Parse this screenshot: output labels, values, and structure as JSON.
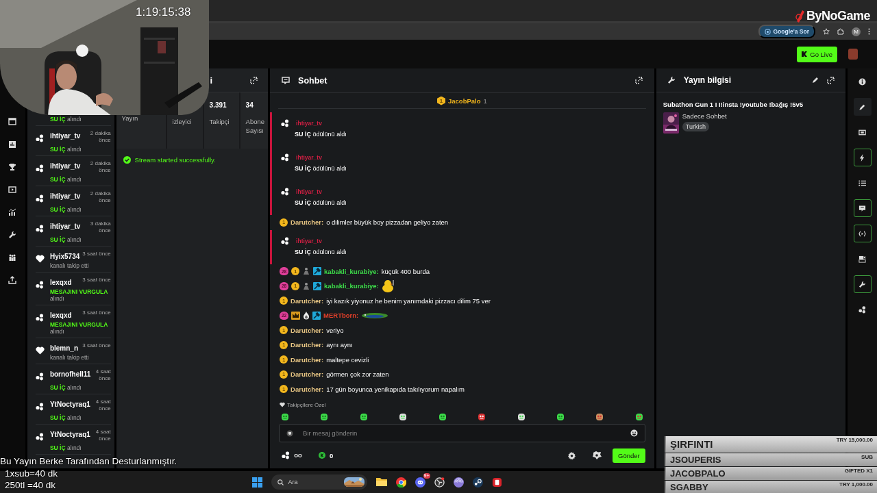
{
  "stream_timer": "1:19:15:38",
  "logo": "ByNoGame",
  "browser": {
    "ai_chip": "Google'a Sor",
    "profile": "M"
  },
  "header": {
    "go_live": "Go Live"
  },
  "activity_feed": [
    {
      "kind": "reward",
      "reward": "SU İÇ",
      "action": "alındı"
    },
    {
      "kind": "reward",
      "user": "ihtiyar_tv",
      "time": "2 dakika önce",
      "reward": "SU İÇ",
      "action": "alındı"
    },
    {
      "kind": "reward",
      "user": "ihtiyar_tv",
      "time": "2 dakika önce",
      "reward": "SU İÇ",
      "action": "alındı"
    },
    {
      "kind": "reward",
      "user": "ihtiyar_tv",
      "time": "2 dakika önce",
      "reward": "SU İÇ",
      "action": "alındı"
    },
    {
      "kind": "reward",
      "user": "ihtiyar_tv",
      "time": "3 dakika önce",
      "reward": "SU İÇ",
      "action": "alındı"
    },
    {
      "kind": "follow",
      "user": "Hyix5734",
      "time": "3 saat önce",
      "action": "kanalı takip etti"
    },
    {
      "kind": "reward",
      "user": "lexqxd",
      "time": "3 saat önce",
      "reward": "MESAJINI VURGULA",
      "action": "alındı"
    },
    {
      "kind": "reward",
      "user": "lexqxd",
      "time": "3 saat önce",
      "reward": "MESAJINI VURGULA",
      "action": "alındı"
    },
    {
      "kind": "follow",
      "user": "blemn_n",
      "time": "3 saat önce",
      "action": "kanalı takip etti"
    },
    {
      "kind": "reward",
      "user": "bornofhell11",
      "time": "4 saat önce",
      "reward": "SU İÇ",
      "action": "alındı"
    },
    {
      "kind": "reward",
      "user": "YtNoctyraq1",
      "time": "4 saat önce",
      "reward": "SU İÇ",
      "action": "alındı"
    },
    {
      "kind": "reward",
      "user": "YtNoctyraq1",
      "time": "4 saat önce",
      "reward": "SU İÇ",
      "action": "alındı"
    }
  ],
  "stats_panel": {
    "title": "i",
    "stats": [
      {
        "label": "Yayın"
      },
      {
        "label": "izleyici"
      },
      {
        "value": "3.391",
        "label": "Takipçi"
      },
      {
        "value": "34",
        "label": "Abone Sayısı"
      }
    ],
    "status": "Stream started successfully."
  },
  "chat": {
    "title": "Sohbet",
    "pinned": {
      "badge": "1",
      "user": "JacobPalo",
      "count": "1"
    },
    "messages": [
      {
        "kind": "reward",
        "user": "ihtiyar_tv",
        "color": "#d11f43",
        "text": "**SU İÇ** ödülünü aldı"
      },
      {
        "kind": "reward",
        "user": "ihtiyar_tv",
        "color": "#d11f43",
        "text": "**SU İÇ** ödülünü aldı"
      },
      {
        "kind": "reward",
        "user": "ihtiyar_tv",
        "color": "#d11f43",
        "text": "**SU İÇ** ödülünü aldı"
      },
      {
        "kind": "message",
        "badges": [
          {
            "kind": "gift",
            "label": "1"
          }
        ],
        "user": "Darutcher:",
        "color": "#e8c684",
        "text": "o dilimler büyük boy pizzadan geliyo zaten"
      },
      {
        "kind": "reward",
        "user": "ihtiyar_tv",
        "color": "#d11f43",
        "text": "**SU İÇ** ödülünü aldı"
      },
      {
        "kind": "message",
        "badges": [
          {
            "kind": "sub",
            "label": "28"
          },
          {
            "kind": "gift",
            "label": "1"
          },
          {
            "kind": "figure"
          },
          {
            "kind": "mod"
          }
        ],
        "user": "kabakli_kurabiye:",
        "color": "#3ddc4a",
        "text": "küçük 400 burda"
      },
      {
        "kind": "duck",
        "badges": [
          {
            "kind": "sub",
            "label": "28"
          },
          {
            "kind": "gift",
            "label": "1"
          },
          {
            "kind": "figure"
          },
          {
            "kind": "mod"
          }
        ],
        "user": "kabakli_kurabiye:",
        "color": "#3ddc4a"
      },
      {
        "kind": "message",
        "badges": [
          {
            "kind": "gift",
            "label": "1"
          }
        ],
        "user": "Darutcher:",
        "color": "#e8c684",
        "text": "iyi kazık yiyonuz he benim yanımdaki pizzacı dilim 75 ver"
      },
      {
        "kind": "lizard",
        "badges": [
          {
            "kind": "sub",
            "label": "22"
          },
          {
            "kind": "crown"
          },
          {
            "kind": "flame"
          },
          {
            "kind": "mod"
          }
        ],
        "user": "MERTborn:",
        "color": "#e8402a"
      },
      {
        "kind": "message",
        "badges": [
          {
            "kind": "gift",
            "label": "1"
          }
        ],
        "user": "Darutcher:",
        "color": "#e8c684",
        "text": "veriyo"
      },
      {
        "kind": "message",
        "badges": [
          {
            "kind": "gift",
            "label": "1"
          }
        ],
        "user": "Darutcher:",
        "color": "#e8c684",
        "text": "aynı aynı"
      },
      {
        "kind": "message",
        "badges": [
          {
            "kind": "gift",
            "label": "1"
          }
        ],
        "user": "Darutcher:",
        "color": "#e8c684",
        "text": "maltepe cevizli"
      },
      {
        "kind": "message",
        "badges": [
          {
            "kind": "gift",
            "label": "1"
          }
        ],
        "user": "Darutcher:",
        "color": "#e8c684",
        "text": "görmen çok zor zaten"
      },
      {
        "kind": "message",
        "badges": [
          {
            "kind": "gift",
            "label": "1"
          }
        ],
        "user": "Darutcher:",
        "color": "#e8c684",
        "text": "17 gün boyunca yenikapıda takılıyorum napalım"
      }
    ],
    "emote_section": "Takipçilere Özel",
    "input": {
      "placeholder": "Bir mesaj gönderin"
    },
    "points": "0",
    "send": "Gönder"
  },
  "stream_info": {
    "title": "Yayın bilgisi",
    "stream_title": "Subathon Gun 1 I I!insta !youtube !bağış !5v5",
    "category": "Sadece Sohbet",
    "tag": "Turkish"
  },
  "right_rail": [
    {
      "kind": "info",
      "outlined": false,
      "selected": false
    },
    {
      "kind": "pencil",
      "outlined": false,
      "selected": true
    },
    {
      "kind": "screen",
      "outlined": false,
      "selected": false
    },
    {
      "kind": "bolt",
      "outlined": true,
      "selected": false
    },
    {
      "kind": "list",
      "outlined": false,
      "selected": false
    },
    {
      "kind": "chat",
      "outlined": true,
      "selected": false
    },
    {
      "kind": "code",
      "outlined": true,
      "selected": false
    },
    {
      "kind": "video",
      "outlined": false,
      "selected": false
    },
    {
      "kind": "wrench",
      "outlined": true,
      "selected": false
    },
    {
      "kind": "dots",
      "outlined": false,
      "selected": false
    }
  ],
  "taskbar": {
    "search": "Ara",
    "discord_badge": "9+"
  },
  "overlay_credits": [
    "Bu Yayın Berke Tarafından Desturlanmıştır.",
    "1xsub=40 dk",
    "250tl =40 dk"
  ],
  "donations": [
    {
      "name": "ŞIRFINTI",
      "amount": "TRY 15,000.00",
      "featured": true
    },
    {
      "name": "JSOUPERIS",
      "amount": "SUB",
      "featured": false
    },
    {
      "name": "JACOBPALO",
      "amount": "GIFTED X1",
      "featured": false
    },
    {
      "name": "SGABBY",
      "amount": "TRY 1,000.00",
      "featured": false
    }
  ]
}
